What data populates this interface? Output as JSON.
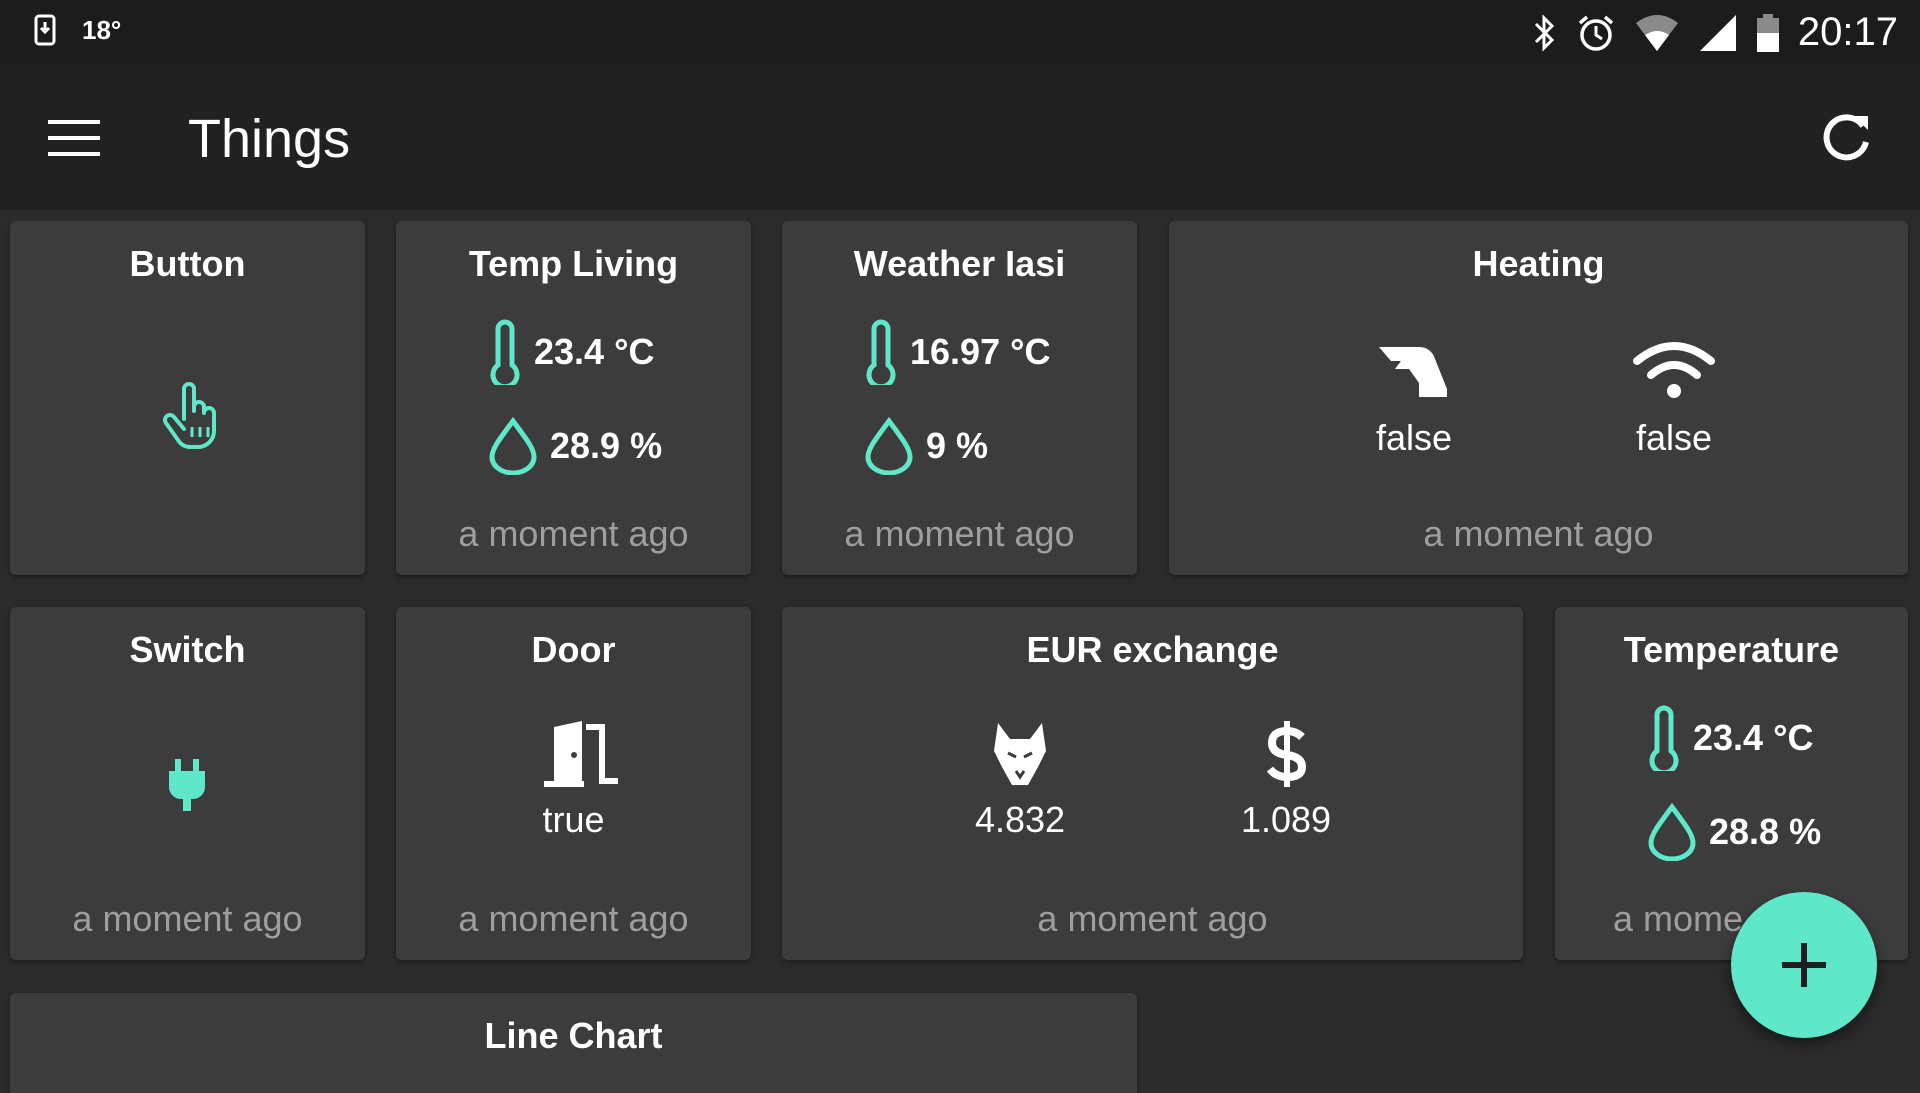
{
  "status_bar": {
    "temperature": "18°",
    "clock": "20:17"
  },
  "app_bar": {
    "title": "Things"
  },
  "accent_color": "#5ee7c8",
  "tiles": {
    "button": {
      "title": "Button",
      "icon": "pointer-hand-icon"
    },
    "temp_living": {
      "title": "Temp Living",
      "temperature": "23.4 °C",
      "humidity": "28.9 %",
      "updated": "a moment ago"
    },
    "weather_iasi": {
      "title": "Weather Iasi",
      "temperature": "16.97 °C",
      "humidity": "9 %",
      "updated": "a moment ago"
    },
    "heating": {
      "title": "Heating",
      "value_1": "false",
      "value_2": "false",
      "updated": "a moment ago"
    },
    "switch": {
      "title": "Switch",
      "icon": "plug-icon",
      "updated": "a moment ago"
    },
    "door": {
      "title": "Door",
      "value": "true",
      "updated": "a moment ago"
    },
    "eur_exchange": {
      "title": "EUR exchange",
      "value_1": "4.832",
      "value_2": "1.089",
      "updated": "a moment ago"
    },
    "temperature": {
      "title": "Temperature",
      "temperature": "23.4 °C",
      "humidity": "28.8 %",
      "updated": "a mome"
    },
    "line_chart": {
      "title": "Line Chart"
    }
  }
}
